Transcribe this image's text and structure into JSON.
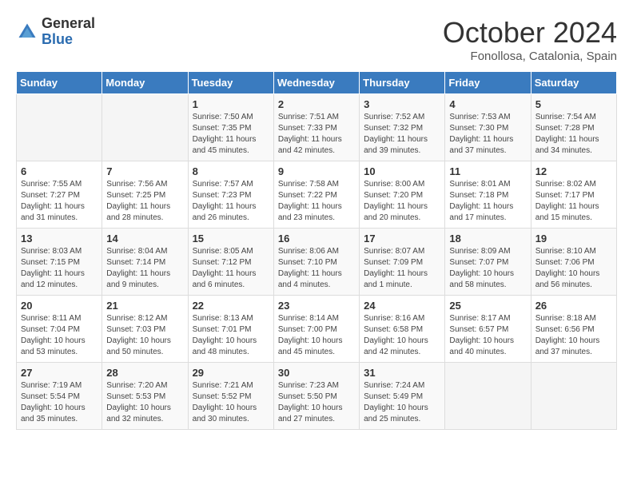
{
  "header": {
    "logo_general": "General",
    "logo_blue": "Blue",
    "month": "October 2024",
    "location": "Fonollosa, Catalonia, Spain"
  },
  "days_of_week": [
    "Sunday",
    "Monday",
    "Tuesday",
    "Wednesday",
    "Thursday",
    "Friday",
    "Saturday"
  ],
  "weeks": [
    [
      {
        "day": "",
        "sunrise": "",
        "sunset": "",
        "daylight": ""
      },
      {
        "day": "",
        "sunrise": "",
        "sunset": "",
        "daylight": ""
      },
      {
        "day": "1",
        "sunrise": "Sunrise: 7:50 AM",
        "sunset": "Sunset: 7:35 PM",
        "daylight": "Daylight: 11 hours and 45 minutes."
      },
      {
        "day": "2",
        "sunrise": "Sunrise: 7:51 AM",
        "sunset": "Sunset: 7:33 PM",
        "daylight": "Daylight: 11 hours and 42 minutes."
      },
      {
        "day": "3",
        "sunrise": "Sunrise: 7:52 AM",
        "sunset": "Sunset: 7:32 PM",
        "daylight": "Daylight: 11 hours and 39 minutes."
      },
      {
        "day": "4",
        "sunrise": "Sunrise: 7:53 AM",
        "sunset": "Sunset: 7:30 PM",
        "daylight": "Daylight: 11 hours and 37 minutes."
      },
      {
        "day": "5",
        "sunrise": "Sunrise: 7:54 AM",
        "sunset": "Sunset: 7:28 PM",
        "daylight": "Daylight: 11 hours and 34 minutes."
      }
    ],
    [
      {
        "day": "6",
        "sunrise": "Sunrise: 7:55 AM",
        "sunset": "Sunset: 7:27 PM",
        "daylight": "Daylight: 11 hours and 31 minutes."
      },
      {
        "day": "7",
        "sunrise": "Sunrise: 7:56 AM",
        "sunset": "Sunset: 7:25 PM",
        "daylight": "Daylight: 11 hours and 28 minutes."
      },
      {
        "day": "8",
        "sunrise": "Sunrise: 7:57 AM",
        "sunset": "Sunset: 7:23 PM",
        "daylight": "Daylight: 11 hours and 26 minutes."
      },
      {
        "day": "9",
        "sunrise": "Sunrise: 7:58 AM",
        "sunset": "Sunset: 7:22 PM",
        "daylight": "Daylight: 11 hours and 23 minutes."
      },
      {
        "day": "10",
        "sunrise": "Sunrise: 8:00 AM",
        "sunset": "Sunset: 7:20 PM",
        "daylight": "Daylight: 11 hours and 20 minutes."
      },
      {
        "day": "11",
        "sunrise": "Sunrise: 8:01 AM",
        "sunset": "Sunset: 7:18 PM",
        "daylight": "Daylight: 11 hours and 17 minutes."
      },
      {
        "day": "12",
        "sunrise": "Sunrise: 8:02 AM",
        "sunset": "Sunset: 7:17 PM",
        "daylight": "Daylight: 11 hours and 15 minutes."
      }
    ],
    [
      {
        "day": "13",
        "sunrise": "Sunrise: 8:03 AM",
        "sunset": "Sunset: 7:15 PM",
        "daylight": "Daylight: 11 hours and 12 minutes."
      },
      {
        "day": "14",
        "sunrise": "Sunrise: 8:04 AM",
        "sunset": "Sunset: 7:14 PM",
        "daylight": "Daylight: 11 hours and 9 minutes."
      },
      {
        "day": "15",
        "sunrise": "Sunrise: 8:05 AM",
        "sunset": "Sunset: 7:12 PM",
        "daylight": "Daylight: 11 hours and 6 minutes."
      },
      {
        "day": "16",
        "sunrise": "Sunrise: 8:06 AM",
        "sunset": "Sunset: 7:10 PM",
        "daylight": "Daylight: 11 hours and 4 minutes."
      },
      {
        "day": "17",
        "sunrise": "Sunrise: 8:07 AM",
        "sunset": "Sunset: 7:09 PM",
        "daylight": "Daylight: 11 hours and 1 minute."
      },
      {
        "day": "18",
        "sunrise": "Sunrise: 8:09 AM",
        "sunset": "Sunset: 7:07 PM",
        "daylight": "Daylight: 10 hours and 58 minutes."
      },
      {
        "day": "19",
        "sunrise": "Sunrise: 8:10 AM",
        "sunset": "Sunset: 7:06 PM",
        "daylight": "Daylight: 10 hours and 56 minutes."
      }
    ],
    [
      {
        "day": "20",
        "sunrise": "Sunrise: 8:11 AM",
        "sunset": "Sunset: 7:04 PM",
        "daylight": "Daylight: 10 hours and 53 minutes."
      },
      {
        "day": "21",
        "sunrise": "Sunrise: 8:12 AM",
        "sunset": "Sunset: 7:03 PM",
        "daylight": "Daylight: 10 hours and 50 minutes."
      },
      {
        "day": "22",
        "sunrise": "Sunrise: 8:13 AM",
        "sunset": "Sunset: 7:01 PM",
        "daylight": "Daylight: 10 hours and 48 minutes."
      },
      {
        "day": "23",
        "sunrise": "Sunrise: 8:14 AM",
        "sunset": "Sunset: 7:00 PM",
        "daylight": "Daylight: 10 hours and 45 minutes."
      },
      {
        "day": "24",
        "sunrise": "Sunrise: 8:16 AM",
        "sunset": "Sunset: 6:58 PM",
        "daylight": "Daylight: 10 hours and 42 minutes."
      },
      {
        "day": "25",
        "sunrise": "Sunrise: 8:17 AM",
        "sunset": "Sunset: 6:57 PM",
        "daylight": "Daylight: 10 hours and 40 minutes."
      },
      {
        "day": "26",
        "sunrise": "Sunrise: 8:18 AM",
        "sunset": "Sunset: 6:56 PM",
        "daylight": "Daylight: 10 hours and 37 minutes."
      }
    ],
    [
      {
        "day": "27",
        "sunrise": "Sunrise: 7:19 AM",
        "sunset": "Sunset: 5:54 PM",
        "daylight": "Daylight: 10 hours and 35 minutes."
      },
      {
        "day": "28",
        "sunrise": "Sunrise: 7:20 AM",
        "sunset": "Sunset: 5:53 PM",
        "daylight": "Daylight: 10 hours and 32 minutes."
      },
      {
        "day": "29",
        "sunrise": "Sunrise: 7:21 AM",
        "sunset": "Sunset: 5:52 PM",
        "daylight": "Daylight: 10 hours and 30 minutes."
      },
      {
        "day": "30",
        "sunrise": "Sunrise: 7:23 AM",
        "sunset": "Sunset: 5:50 PM",
        "daylight": "Daylight: 10 hours and 27 minutes."
      },
      {
        "day": "31",
        "sunrise": "Sunrise: 7:24 AM",
        "sunset": "Sunset: 5:49 PM",
        "daylight": "Daylight: 10 hours and 25 minutes."
      },
      {
        "day": "",
        "sunrise": "",
        "sunset": "",
        "daylight": ""
      },
      {
        "day": "",
        "sunrise": "",
        "sunset": "",
        "daylight": ""
      }
    ]
  ]
}
